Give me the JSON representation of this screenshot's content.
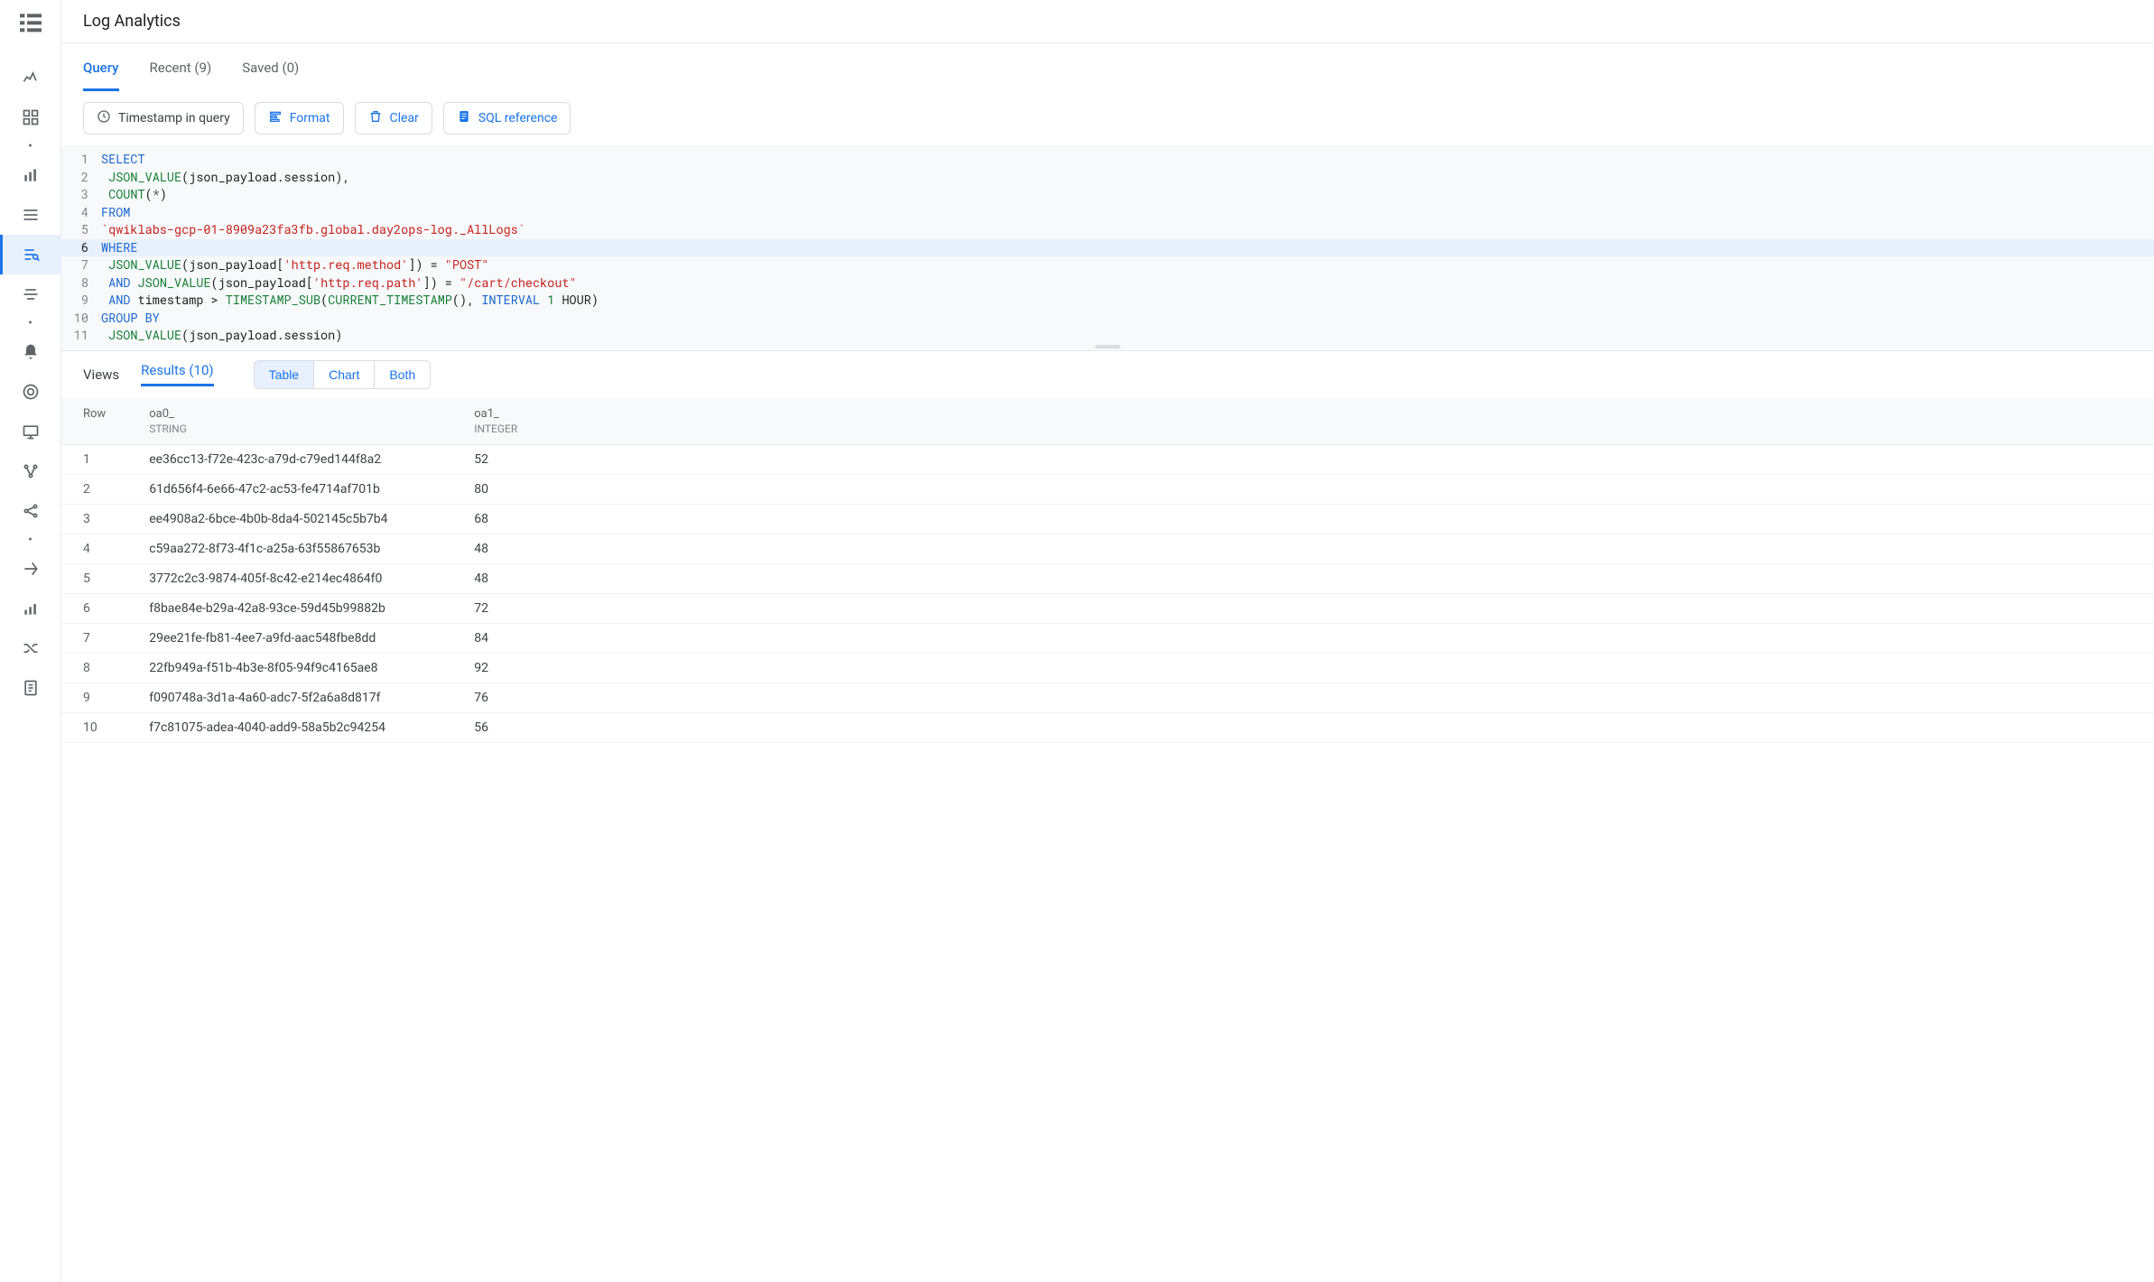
{
  "page_title": "Log Analytics",
  "tabs": [
    {
      "label": "Query",
      "active": true
    },
    {
      "label": "Recent (9)",
      "active": false
    },
    {
      "label": "Saved (0)",
      "active": false
    }
  ],
  "toolbar": {
    "timestamp": "Timestamp in query",
    "format": "Format",
    "clear": "Clear",
    "sql_ref": "SQL reference"
  },
  "editor": {
    "highlighted_line": 6,
    "lines": [
      {
        "n": 1,
        "tokens": [
          {
            "t": "SELECT",
            "c": "kw"
          }
        ]
      },
      {
        "n": 2,
        "tokens": [
          {
            "t": " ",
            "c": ""
          },
          {
            "t": "JSON_VALUE",
            "c": "fn"
          },
          {
            "t": "(json_payload.session),",
            "c": ""
          }
        ]
      },
      {
        "n": 3,
        "tokens": [
          {
            "t": " ",
            "c": ""
          },
          {
            "t": "COUNT",
            "c": "fn"
          },
          {
            "t": "(",
            "c": ""
          },
          {
            "t": "*",
            "c": "op"
          },
          {
            "t": ")",
            "c": ""
          }
        ]
      },
      {
        "n": 4,
        "tokens": [
          {
            "t": "FROM",
            "c": "kw"
          }
        ]
      },
      {
        "n": 5,
        "tokens": [
          {
            "t": "`qwiklabs-gcp-01-8909a23fa3fb.global.day2ops-log._AllLogs`",
            "c": "tbl"
          }
        ]
      },
      {
        "n": 6,
        "tokens": [
          {
            "t": "WHERE",
            "c": "kw"
          }
        ]
      },
      {
        "n": 7,
        "tokens": [
          {
            "t": " ",
            "c": ""
          },
          {
            "t": "JSON_VALUE",
            "c": "fn"
          },
          {
            "t": "(json_payload[",
            "c": ""
          },
          {
            "t": "'http.req.method'",
            "c": "str"
          },
          {
            "t": "]) = ",
            "c": ""
          },
          {
            "t": "\"POST\"",
            "c": "str"
          }
        ]
      },
      {
        "n": 8,
        "tokens": [
          {
            "t": " ",
            "c": ""
          },
          {
            "t": "AND",
            "c": "kw"
          },
          {
            "t": " ",
            "c": ""
          },
          {
            "t": "JSON_VALUE",
            "c": "fn"
          },
          {
            "t": "(json_payload[",
            "c": ""
          },
          {
            "t": "'http.req.path'",
            "c": "str"
          },
          {
            "t": "]) = ",
            "c": ""
          },
          {
            "t": "\"/cart/checkout\"",
            "c": "str"
          }
        ]
      },
      {
        "n": 9,
        "tokens": [
          {
            "t": " ",
            "c": ""
          },
          {
            "t": "AND",
            "c": "kw"
          },
          {
            "t": " timestamp > ",
            "c": ""
          },
          {
            "t": "TIMESTAMP_SUB",
            "c": "fn"
          },
          {
            "t": "(",
            "c": ""
          },
          {
            "t": "CURRENT_TIMESTAMP",
            "c": "fn"
          },
          {
            "t": "(), ",
            "c": ""
          },
          {
            "t": "INTERVAL",
            "c": "kw"
          },
          {
            "t": " ",
            "c": ""
          },
          {
            "t": "1",
            "c": "num"
          },
          {
            "t": " HOUR)",
            "c": ""
          }
        ]
      },
      {
        "n": 10,
        "tokens": [
          {
            "t": "GROUP BY",
            "c": "kw"
          }
        ]
      },
      {
        "n": 11,
        "tokens": [
          {
            "t": " ",
            "c": ""
          },
          {
            "t": "JSON_VALUE",
            "c": "fn"
          },
          {
            "t": "(json_payload.session)",
            "c": ""
          }
        ]
      }
    ]
  },
  "results_bar": {
    "views": "Views",
    "results": "Results (10)",
    "seg": {
      "table": "Table",
      "chart": "Chart",
      "both": "Both",
      "active": "table"
    }
  },
  "results": {
    "columns": [
      {
        "name": "Row",
        "type": ""
      },
      {
        "name": "oa0_",
        "type": "STRING"
      },
      {
        "name": "oa1_",
        "type": "INTEGER"
      }
    ],
    "rows": [
      {
        "n": 1,
        "c0": "ee36cc13-f72e-423c-a79d-c79ed144f8a2",
        "c1": "52"
      },
      {
        "n": 2,
        "c0": "61d656f4-6e66-47c2-ac53-fe4714af701b",
        "c1": "80"
      },
      {
        "n": 3,
        "c0": "ee4908a2-6bce-4b0b-8da4-502145c5b7b4",
        "c1": "68"
      },
      {
        "n": 4,
        "c0": "c59aa272-8f73-4f1c-a25a-63f55867653b",
        "c1": "48"
      },
      {
        "n": 5,
        "c0": "3772c2c3-9874-405f-8c42-e214ec4864f0",
        "c1": "48"
      },
      {
        "n": 6,
        "c0": "f8bae84e-b29a-42a8-93ce-59d45b99882b",
        "c1": "72"
      },
      {
        "n": 7,
        "c0": "29ee21fe-fb81-4ee7-a9fd-aac548fbe8dd",
        "c1": "84"
      },
      {
        "n": 8,
        "c0": "22fb949a-f51b-4b3e-8f05-94f9c4165ae8",
        "c1": "92"
      },
      {
        "n": 9,
        "c0": "f090748a-3d1a-4a60-adc7-5f2a6a8d817f",
        "c1": "76"
      },
      {
        "n": 10,
        "c0": "f7c81075-adea-4040-add9-58a5b2c94254",
        "c1": "56"
      }
    ]
  }
}
